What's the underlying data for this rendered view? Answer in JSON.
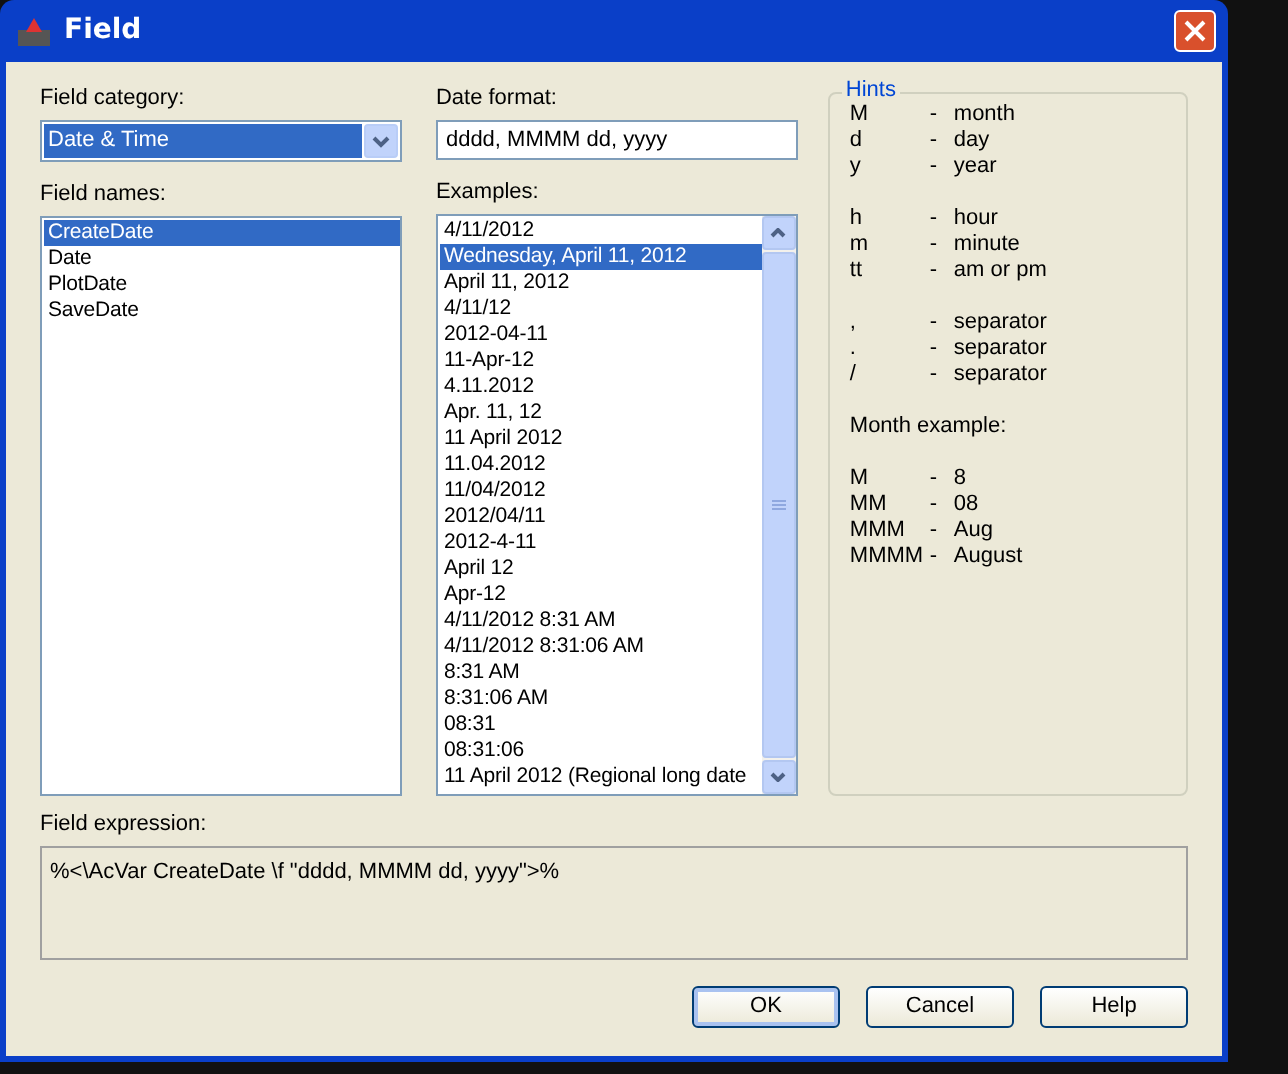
{
  "window": {
    "title": "Field"
  },
  "field_category": {
    "label": "Field category:",
    "value": "Date & Time"
  },
  "field_names": {
    "label": "Field names:",
    "items": [
      {
        "text": "CreateDate",
        "selected": true
      },
      {
        "text": "Date",
        "selected": false
      },
      {
        "text": "PlotDate",
        "selected": false
      },
      {
        "text": "SaveDate",
        "selected": false
      }
    ]
  },
  "date_format": {
    "label": "Date format:",
    "value": "dddd, MMMM dd, yyyy"
  },
  "examples": {
    "label": "Examples:",
    "items": [
      {
        "text": "4/11/2012",
        "selected": false
      },
      {
        "text": "Wednesday, April 11, 2012",
        "selected": true
      },
      {
        "text": "April 11, 2012",
        "selected": false
      },
      {
        "text": "4/11/12",
        "selected": false
      },
      {
        "text": "2012-04-11",
        "selected": false
      },
      {
        "text": "11-Apr-12",
        "selected": false
      },
      {
        "text": "4.11.2012",
        "selected": false
      },
      {
        "text": "Apr. 11, 12",
        "selected": false
      },
      {
        "text": "11 April 2012",
        "selected": false
      },
      {
        "text": "11.04.2012",
        "selected": false
      },
      {
        "text": "11/04/2012",
        "selected": false
      },
      {
        "text": "2012/04/11",
        "selected": false
      },
      {
        "text": "2012-4-11",
        "selected": false
      },
      {
        "text": "April 12",
        "selected": false
      },
      {
        "text": "Apr-12",
        "selected": false
      },
      {
        "text": "4/11/2012 8:31 AM",
        "selected": false
      },
      {
        "text": "4/11/2012 8:31:06 AM",
        "selected": false
      },
      {
        "text": "8:31 AM",
        "selected": false
      },
      {
        "text": "8:31:06 AM",
        "selected": false
      },
      {
        "text": "08:31",
        "selected": false
      },
      {
        "text": "08:31:06",
        "selected": false
      },
      {
        "text": "11 April 2012 (Regional long date",
        "selected": false
      }
    ]
  },
  "hints": {
    "title": "Hints",
    "groups": [
      [
        {
          "key": "M",
          "dash": "-",
          "meaning": "month"
        },
        {
          "key": "d",
          "dash": "-",
          "meaning": "day"
        },
        {
          "key": "y",
          "dash": "-",
          "meaning": "year"
        }
      ],
      [
        {
          "key": "h",
          "dash": "-",
          "meaning": "hour"
        },
        {
          "key": "m",
          "dash": "-",
          "meaning": "minute"
        },
        {
          "key": "tt",
          "dash": "-",
          "meaning": "am or pm"
        }
      ],
      [
        {
          "key": ",",
          "dash": "-",
          "meaning": "separator"
        },
        {
          "key": ".",
          "dash": "-",
          "meaning": "separator"
        },
        {
          "key": "/",
          "dash": "-",
          "meaning": "separator"
        }
      ]
    ],
    "month_example_title": "Month example:",
    "month_examples": [
      {
        "key": "M",
        "dash": "-",
        "meaning": "8"
      },
      {
        "key": "MM",
        "dash": "-",
        "meaning": "08"
      },
      {
        "key": "MMM",
        "dash": "-",
        "meaning": "Aug"
      },
      {
        "key": "MMMM",
        "dash": "-",
        "meaning": "August"
      }
    ]
  },
  "field_expression": {
    "label": "Field expression:",
    "value": "%<\\AcVar CreateDate \\f \"dddd, MMMM dd, yyyy\">%"
  },
  "buttons": [
    {
      "label": "OK",
      "default": true
    },
    {
      "label": "Cancel",
      "default": false
    },
    {
      "label": "Help",
      "default": false
    }
  ]
}
